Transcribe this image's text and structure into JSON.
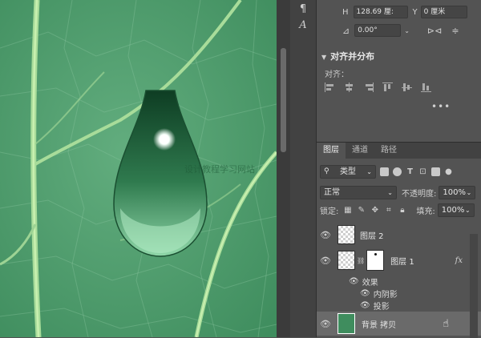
{
  "properties": {
    "h_label": "H",
    "h_value": "128.69 厘:",
    "y_label": "Y",
    "y_value": "0 厘米",
    "angle_value": "0.00°",
    "section_title": "对齐并分布",
    "align_label": "对齐："
  },
  "watermark": "设计教程学习网站",
  "layers_panel": {
    "tabs": [
      "图层",
      "通道",
      "路径"
    ],
    "filter_kind": "类型",
    "blend_mode": "正常",
    "opacity_label": "不透明度:",
    "opacity_value": "100%",
    "lock_label": "锁定:",
    "fill_label": "填充:",
    "fill_value": "100%",
    "layers": [
      {
        "name": "图层 2"
      },
      {
        "name": "图层 1",
        "fx": "fx"
      },
      {
        "name": "背景 拷贝"
      }
    ],
    "effects_label": "效果",
    "effect_1": "内阴影",
    "effect_2": "投影"
  },
  "colors": {
    "panel_bg": "#535353",
    "leaf_green": "#5aa876"
  }
}
